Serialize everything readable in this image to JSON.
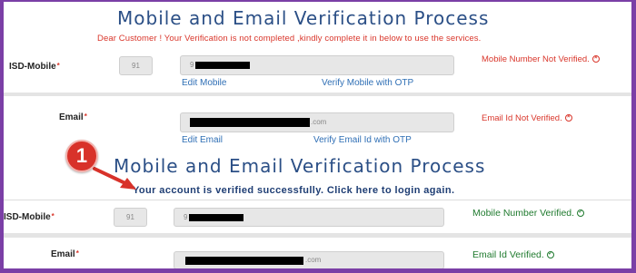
{
  "top": {
    "title": "Mobile and Email Verification Process",
    "notice": "Dear Customer ! Your Verification is not completed ,kindly complete it in below to use the services.",
    "mobile_label": "ISD-Mobile",
    "required_mark": "*",
    "isd_value": "91",
    "mobile_prefix": "9",
    "edit_mobile": "Edit Mobile",
    "verify_mobile": "Verify Mobile with OTP",
    "mobile_status": "Mobile Number Not Verified.",
    "email_label": "Email",
    "email_suffix": ".com",
    "edit_email": "Edit Email",
    "verify_email": "Verify Email Id with OTP",
    "email_status": "Email Id Not Verified."
  },
  "bottom": {
    "title": "Mobile and Email Verification Process",
    "success": "Your account is verified successfully. Click here to login again.",
    "mobile_label": "ISD-Mobile",
    "required_mark": "*",
    "isd_value": "91",
    "mobile_prefix": "9",
    "mobile_status": "Mobile Number Verified.",
    "email_label": "Email",
    "email_suffix": ".com",
    "email_status": "Email Id Verified."
  },
  "callout": {
    "number": "1"
  },
  "icons": {
    "not_verified": "x-circle-icon",
    "verified": "check-circle-icon"
  },
  "colors": {
    "border": "#7b3fa6",
    "title": "#2b4f86",
    "error": "#d9362b",
    "success_status": "#1f7a2e",
    "link": "#2f6fb5",
    "badge": "#d8322a"
  }
}
